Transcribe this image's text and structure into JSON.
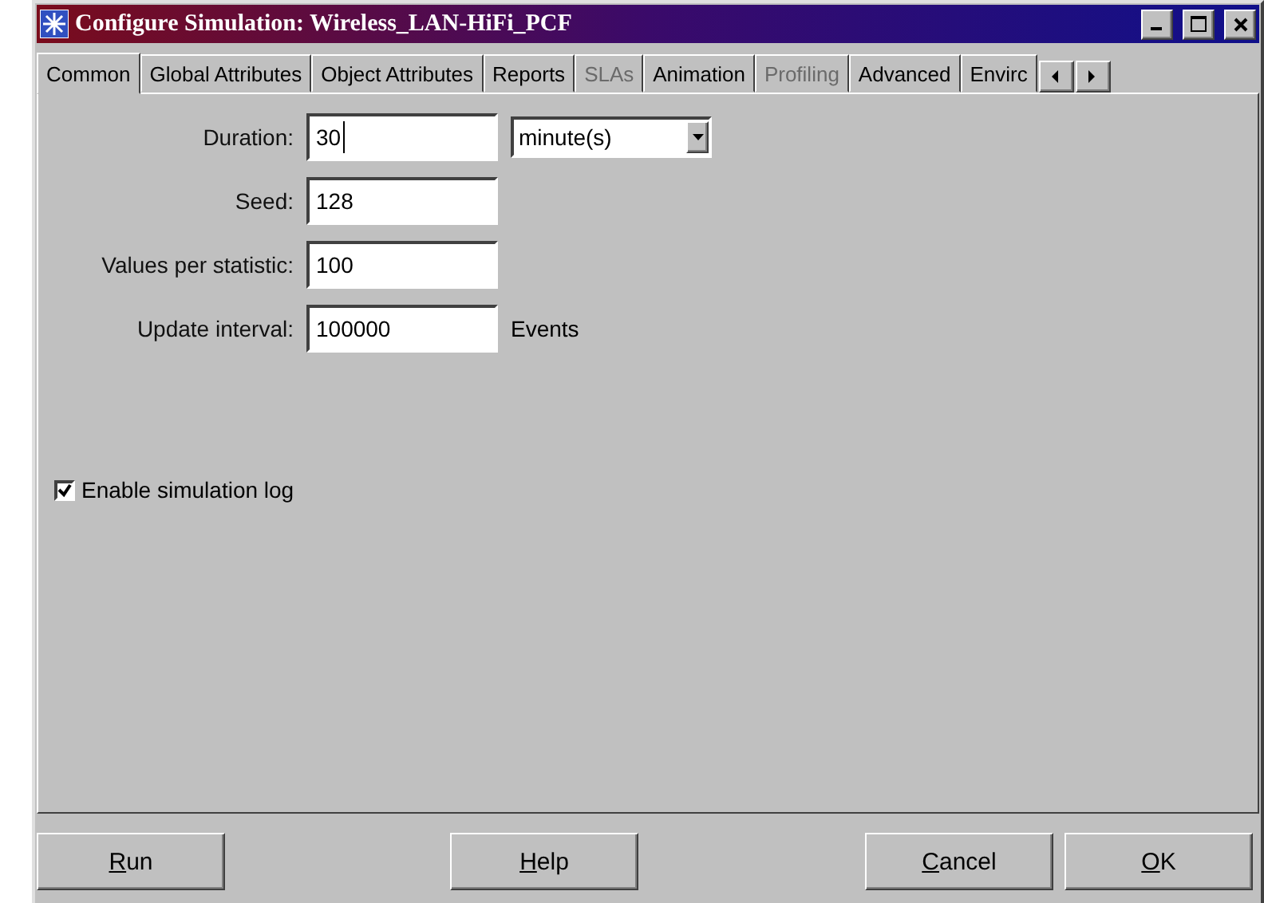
{
  "window": {
    "title": "Configure Simulation: Wireless_LAN-HiFi_PCF"
  },
  "tabs": [
    {
      "label": "Common",
      "selected": true,
      "disabled": false
    },
    {
      "label": "Global Attributes",
      "selected": false,
      "disabled": false
    },
    {
      "label": "Object Attributes",
      "selected": false,
      "disabled": false
    },
    {
      "label": "Reports",
      "selected": false,
      "disabled": false
    },
    {
      "label": "SLAs",
      "selected": false,
      "disabled": true
    },
    {
      "label": "Animation",
      "selected": false,
      "disabled": false
    },
    {
      "label": "Profiling",
      "selected": false,
      "disabled": true
    },
    {
      "label": "Advanced",
      "selected": false,
      "disabled": false
    },
    {
      "label": "Envirc",
      "selected": false,
      "disabled": false
    }
  ],
  "fields": [
    {
      "label": "Duration:",
      "value": "30",
      "focused": true,
      "dropdown": "minute(s)"
    },
    {
      "label": "Seed:",
      "value": "128",
      "focused": false
    },
    {
      "label": "Values per statistic:",
      "value": "100",
      "focused": false
    },
    {
      "label": "Update interval:",
      "value": "100000",
      "focused": false,
      "suffix": "Events"
    }
  ],
  "checkbox": {
    "label": "Enable simulation log",
    "checked": true
  },
  "buttons": [
    {
      "key": "R",
      "after": "un"
    },
    {
      "key": "H",
      "after": "elp"
    },
    {
      "key": "C",
      "after": "ancel"
    },
    {
      "key": "O",
      "after": "K"
    }
  ]
}
